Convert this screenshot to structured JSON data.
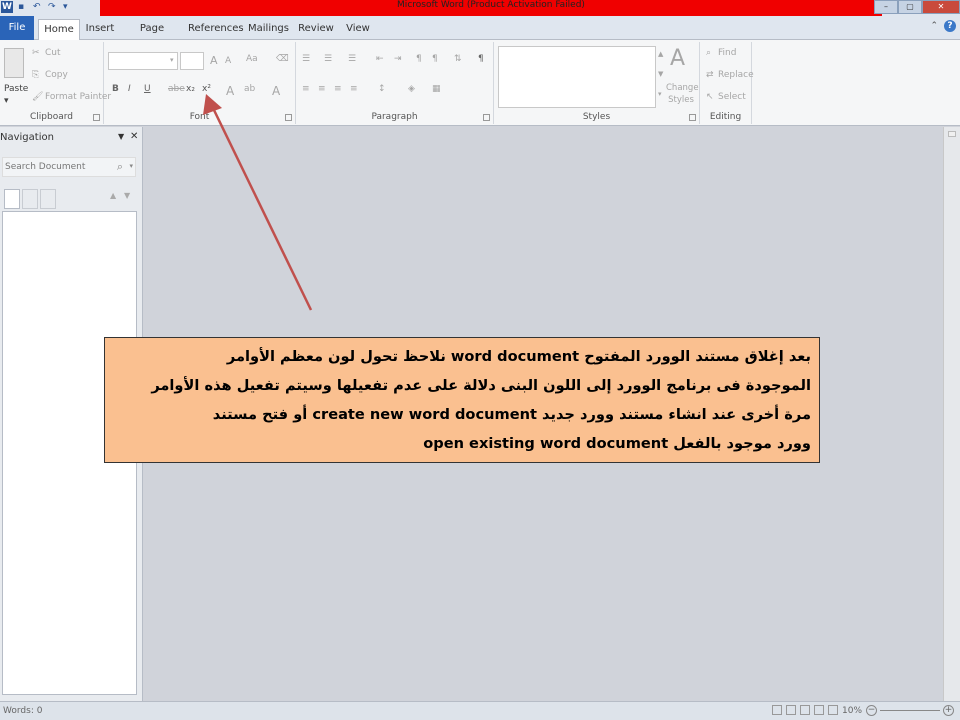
{
  "window": {
    "title": "Microsoft Word (Product Activation Failed)",
    "qat_icons": [
      "word-logo-icon",
      "save-icon",
      "undo-icon",
      "redo-icon",
      "customize-qat-icon"
    ],
    "controls": {
      "minimize": "–",
      "restore": "▢",
      "close": "✕"
    }
  },
  "tabs": {
    "file": "File",
    "home": "Home",
    "insert": "Insert",
    "page_layout": "Page Layout",
    "references": "References",
    "mailings": "Mailings",
    "review": "Review",
    "view": "View"
  },
  "ribbon": {
    "clipboard": {
      "label": "Clipboard",
      "paste": "Paste",
      "cut": "Cut",
      "copy": "Copy",
      "format_painter": "Format Painter"
    },
    "font": {
      "label": "Font",
      "bold": "B",
      "italic": "I",
      "underline": "U",
      "strike": "abe",
      "subscript": "x₂",
      "superscript": "x²",
      "grow": "A",
      "shrink": "A",
      "case": "Aa"
    },
    "paragraph": {
      "label": "Paragraph",
      "pilcrow": "¶"
    },
    "styles": {
      "label": "Styles",
      "change_styles": "Change Styles"
    },
    "editing": {
      "label": "Editing",
      "find": "Find",
      "replace": "Replace",
      "select": "Select"
    }
  },
  "navigation": {
    "title": "Navigation",
    "search_placeholder": "Search Document",
    "close": "✕"
  },
  "status": {
    "words": "Words: 0",
    "zoom": "10%"
  },
  "callout": {
    "line1": "بعد إغلاق مستند الوورد المفتوح word document نلاحظ تحول لون معظم الأوامر",
    "line2": "الموجودة فى برنامج الوورد إلى اللون البنى دلالة على عدم تفعيلها وسيتم تفعيل هذه الأوامر",
    "line3": "مرة أخرى عند انشاء مستند وورد جديد create new word document أو فتح مستند",
    "line4": "وورد موجود بالفعل open existing word document"
  },
  "colors": {
    "title_bar_red": "#f00000",
    "file_tab": "#2a64b8",
    "callout_fill": "#fac090",
    "arrow": "#c0504d"
  }
}
